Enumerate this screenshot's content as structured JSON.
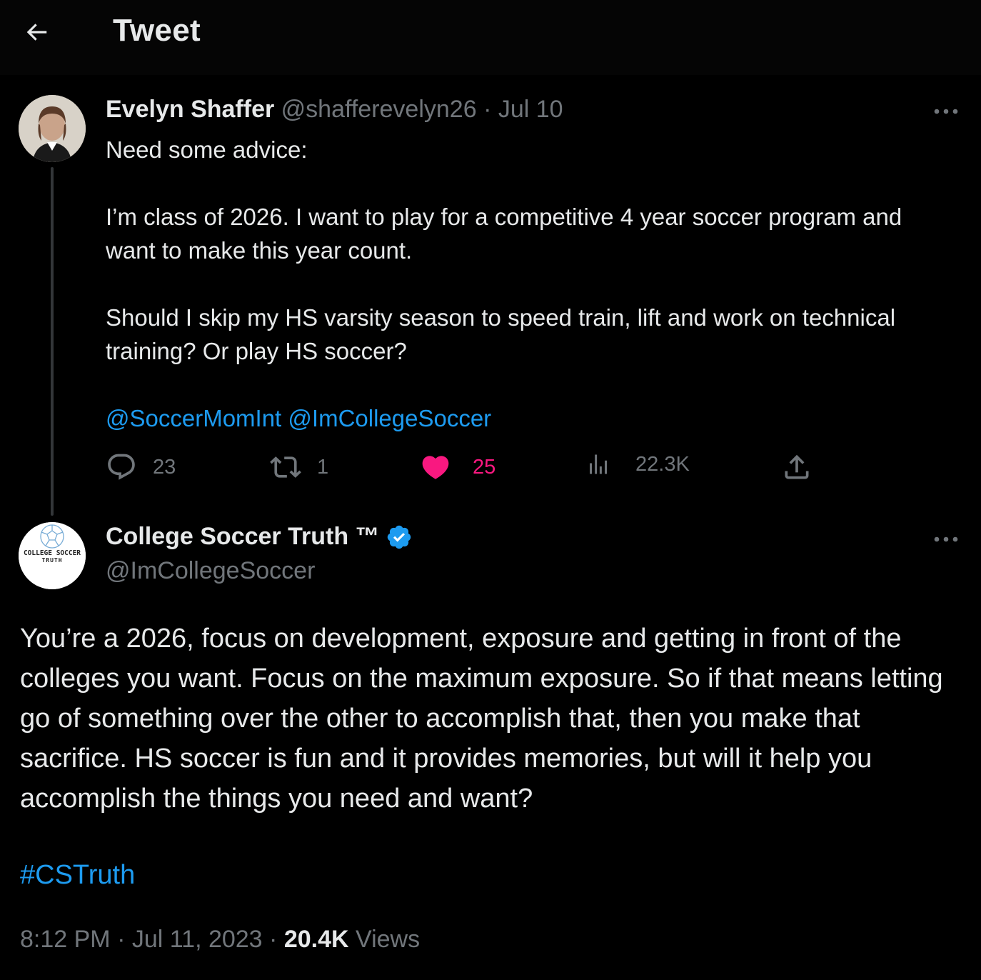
{
  "header": {
    "back_icon": "arrow-left-icon",
    "title": "Tweet"
  },
  "original_tweet": {
    "author_name": "Evelyn Shaffer",
    "author_handle": "@shafferevelyn26",
    "separator": "·",
    "date": "Jul 10",
    "text_line1": "Need some advice:",
    "text_para2": "I’m class of 2026. I want to play for a competitive 4 year soccer program and want to make this year count.",
    "text_para3": "Should I skip my HS varsity season to speed train, lift and work on technical training?  Or play HS soccer?",
    "mention1": "@SoccerMomInt",
    "mention2": "@ImCollegeSoccer",
    "actions": {
      "replies": "23",
      "retweets": "1",
      "likes": "25",
      "views": "22.3K"
    }
  },
  "reply_tweet": {
    "author_name": "College Soccer Truth ™",
    "author_handle": "@ImCollegeSoccer",
    "avatar_text_line1": "COLLEGE SOCCER",
    "avatar_text_line2": "TRUTH",
    "text": "You’re a 2026, focus on development, exposure and getting in front of the colleges you want. Focus on the maximum exposure. So if that means letting go of something over the other to accomplish that, then you make that sacrifice. HS soccer is fun and it provides memories, but will it help you accomplish the things you need and want?",
    "hashtag": "#CSTruth",
    "time": "8:12 PM",
    "separator": "·",
    "date": "Jul 11, 2023",
    "views_count": "20.4K",
    "views_label": "Views"
  },
  "colors": {
    "background": "#000000",
    "text": "#e7e9ea",
    "muted": "#71767b",
    "link": "#1d9bf0",
    "like": "#f91880"
  }
}
